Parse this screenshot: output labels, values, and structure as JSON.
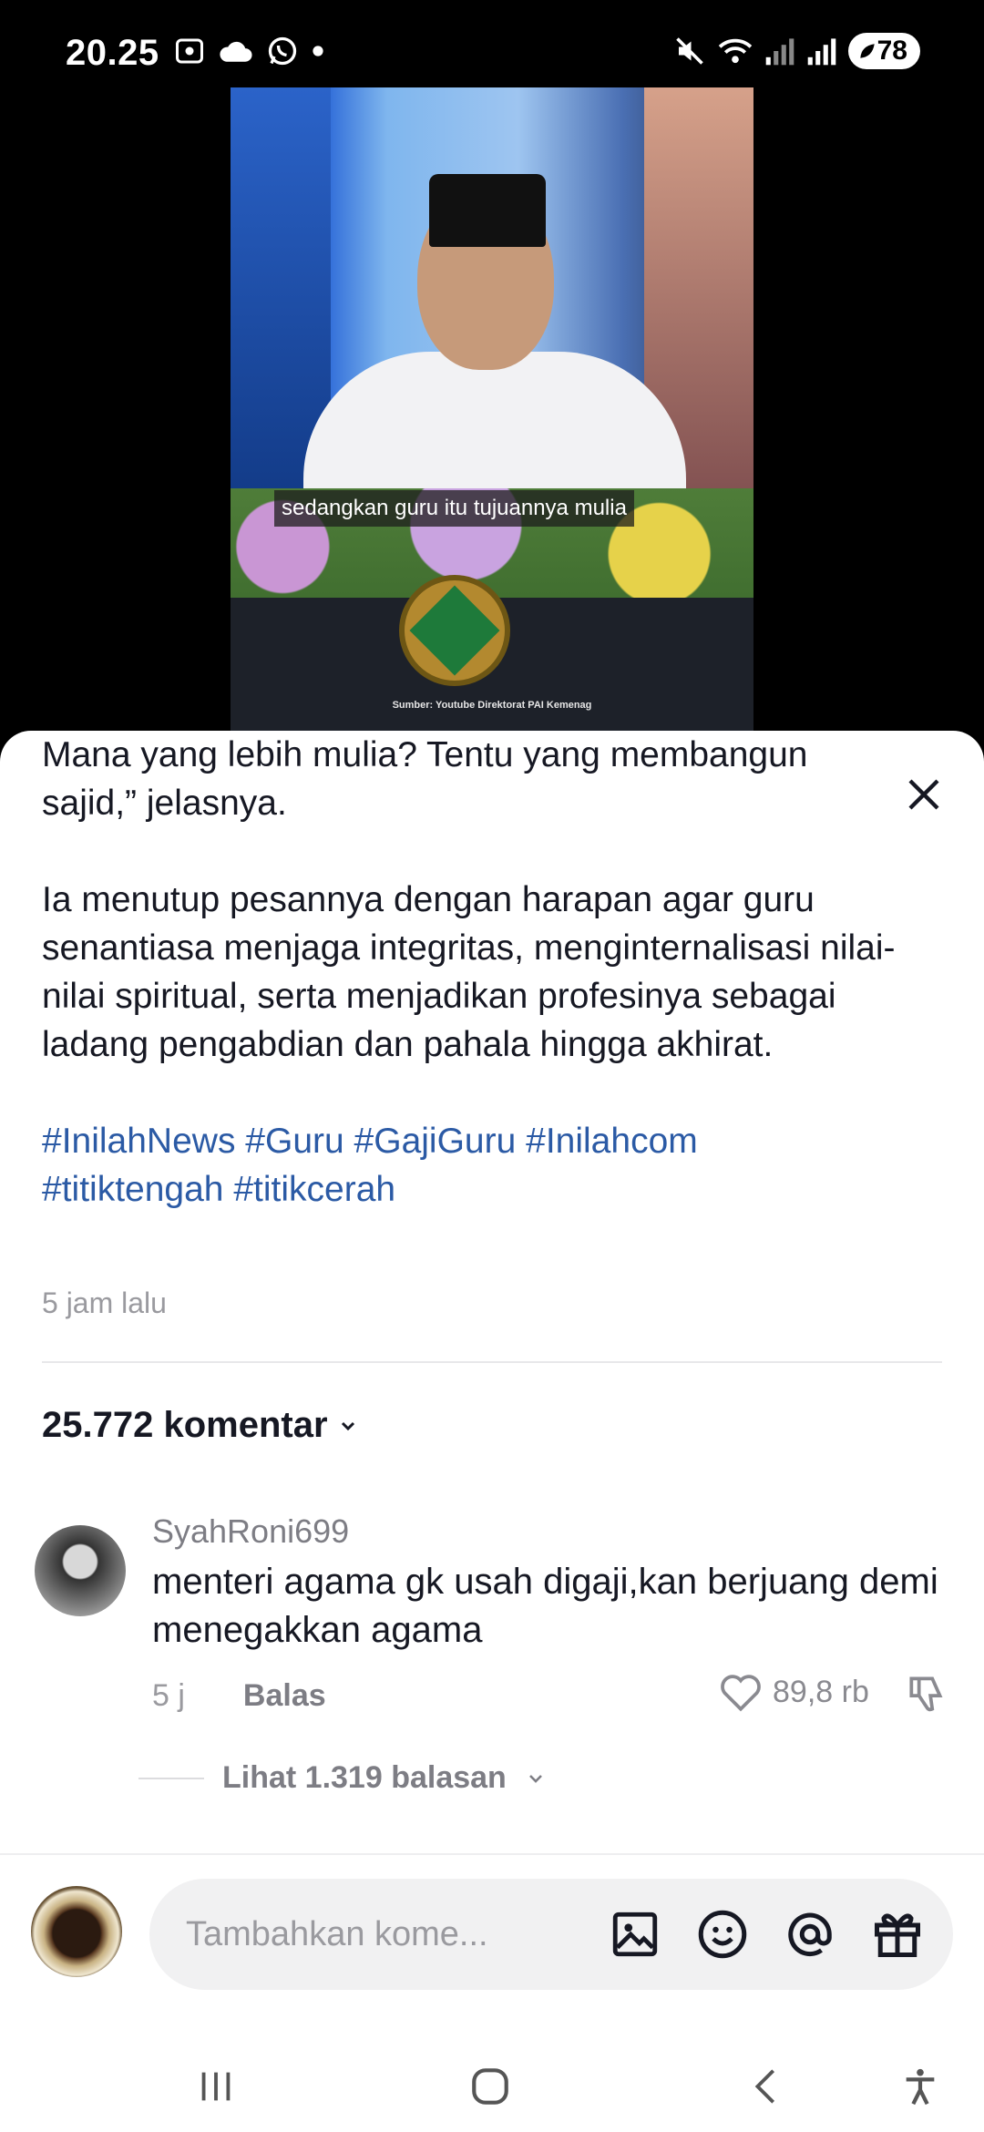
{
  "status_bar": {
    "time": "20.25",
    "battery": "78"
  },
  "video": {
    "subtitle": "sedangkan guru itu tujuannya mulia",
    "source": "Sumber: Youtube Direktorat PAI Kemenag"
  },
  "caption": {
    "line1": "Mana yang lebih mulia? Tentu yang membangun",
    "line2": "sajid,” jelasnya.",
    "paragraph2": "Ia menutup pesannya dengan harapan agar guru senantiasa menjaga integritas, menginternalisasi nilai-nilai spiritual, serta menjadikan profesinya sebagai ladang pengabdian dan pahala hingga akhirat.",
    "hashtags": [
      "#InilahNews",
      "#Guru",
      "#GajiGuru",
      "#Inilahcom",
      "#titiktengah",
      "#titikcerah"
    ],
    "time_ago": "5 jam lalu"
  },
  "comments_header": {
    "count_label": "25.772 komentar"
  },
  "comment": {
    "username": "SyahRoni699",
    "text": "menteri agama gk usah digaji,kan berjuang demi menegakkan agama",
    "time": "5 j",
    "reply_label": "Balas",
    "likes": "89,8 rb",
    "view_replies": "Lihat 1.319 balasan"
  },
  "input_bar": {
    "placeholder": "Tambahkan kome..."
  },
  "icons": {
    "close": "close-icon",
    "image": "image-icon",
    "emoji": "emoji-icon",
    "mention": "at-icon",
    "gift": "gift-icon"
  }
}
